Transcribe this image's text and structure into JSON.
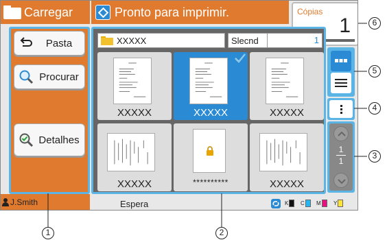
{
  "header": {
    "title": "Carregar",
    "status_message": "Pronto para imprimir."
  },
  "copies": {
    "label": "Cópias",
    "value": "1"
  },
  "left_buttons": [
    {
      "label": "Pasta",
      "icon": "back-arrow-icon"
    },
    {
      "label": "Procurar",
      "icon": "magnifier-icon"
    },
    {
      "label": "Detalhes",
      "icon": "magnifier-check-icon"
    }
  ],
  "path": {
    "folder_name": "XXXXX"
  },
  "selected_count": {
    "label": "Slecnd",
    "value": "1"
  },
  "thumbnails": [
    {
      "name": "XXXXX",
      "selected": false,
      "locked": false,
      "orientation": "portrait"
    },
    {
      "name": "XXXXX",
      "selected": true,
      "locked": false,
      "orientation": "portrait"
    },
    {
      "name": "XXXXX",
      "selected": false,
      "locked": false,
      "orientation": "portrait"
    },
    {
      "name": "XXXXX",
      "selected": false,
      "locked": false,
      "orientation": "landscape"
    },
    {
      "name": "**********",
      "selected": false,
      "locked": true,
      "orientation": "portrait"
    },
    {
      "name": "XXXXX",
      "selected": false,
      "locked": false,
      "orientation": "landscape"
    }
  ],
  "pagination": {
    "current": "1",
    "total": "1"
  },
  "statusbar": {
    "user": "J.Smith",
    "state": "Espera",
    "inks": [
      {
        "letter": "K",
        "color": "#111111"
      },
      {
        "letter": "C",
        "color": "#29b6f0"
      },
      {
        "letter": "M",
        "color": "#e4127f"
      },
      {
        "letter": "Y",
        "color": "#ffe433"
      }
    ]
  },
  "callouts": [
    "1",
    "2",
    "3",
    "4",
    "5",
    "6"
  ],
  "colors": {
    "accent": "#e07a2e",
    "highlight": "#5ab4e6",
    "selected": "#2a8ad4"
  }
}
